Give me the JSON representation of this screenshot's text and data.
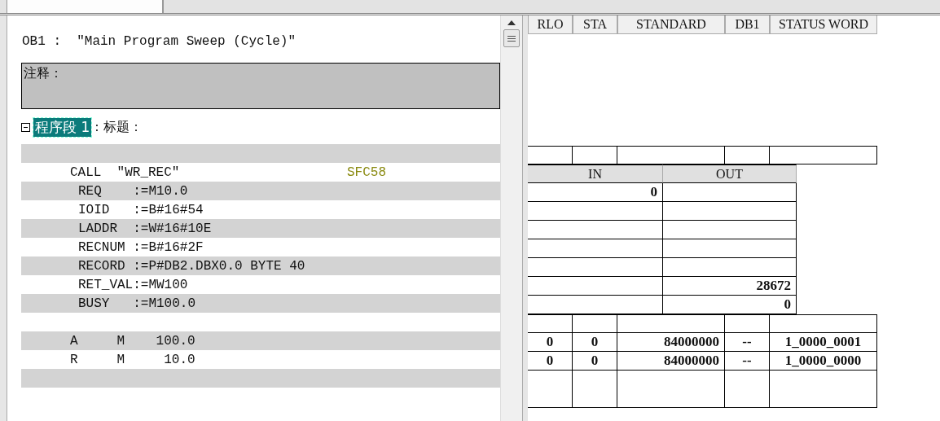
{
  "editor": {
    "title": "OB1 :  \"Main Program Sweep (Cycle)\"",
    "comment_label": "注释：",
    "network": {
      "expanded": true,
      "label": "程序段 1",
      "selected": true,
      "title_label": ": 标题："
    },
    "lines": [
      {
        "kind": "blank"
      },
      {
        "kind": "call",
        "text": "CALL  \"WR_REC\"",
        "block": "SFC58"
      },
      {
        "kind": "param",
        "text": "REQ    :=M10.0"
      },
      {
        "kind": "param",
        "text": "IOID   :=B#16#54"
      },
      {
        "kind": "param",
        "text": "LADDR  :=W#16#10E"
      },
      {
        "kind": "param",
        "text": "RECNUM :=B#16#2F"
      },
      {
        "kind": "param",
        "text": "RECORD :=P#DB2.DBX0.0 BYTE 40"
      },
      {
        "kind": "param",
        "text": "RET_VAL:=MW100"
      },
      {
        "kind": "param",
        "text": "BUSY   :=M100.0"
      },
      {
        "kind": "blank"
      },
      {
        "kind": "stmt",
        "text": "A     M    100.0"
      },
      {
        "kind": "stmt",
        "text": "R     M     10.0"
      },
      {
        "kind": "blank"
      }
    ]
  },
  "status": {
    "columns": [
      "RLO",
      "STA",
      "STANDARD",
      "DB1",
      "STATUS WORD"
    ],
    "param_columns": [
      "IN",
      "OUT"
    ],
    "rows": [
      {
        "kind": "status"
      },
      {
        "kind": "param_header"
      },
      {
        "kind": "param",
        "in": "0"
      },
      {
        "kind": "param"
      },
      {
        "kind": "param"
      },
      {
        "kind": "param"
      },
      {
        "kind": "param"
      },
      {
        "kind": "param",
        "out": "28672"
      },
      {
        "kind": "param",
        "out": "0"
      },
      {
        "kind": "status"
      },
      {
        "kind": "status",
        "cells": [
          "0",
          "0",
          "84000000",
          "--",
          "1_0000_0001"
        ]
      },
      {
        "kind": "status",
        "cells": [
          "0",
          "0",
          "84000000",
          "--",
          "1_0000_0000"
        ]
      },
      {
        "kind": "status_tall"
      }
    ]
  }
}
